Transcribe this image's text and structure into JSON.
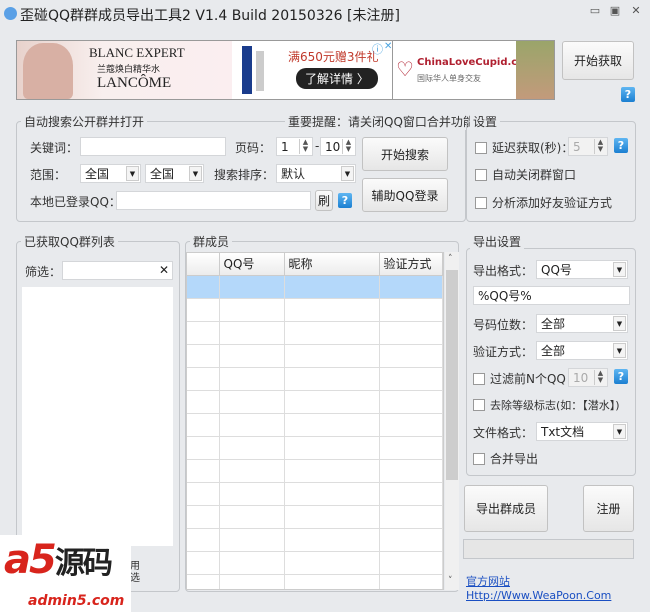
{
  "window": {
    "title": "歪碰QQ群群成员导出工具2 V1.4 Build 20150326   [未注册]",
    "minimize": "▭",
    "maximize": "▣",
    "close": "✕"
  },
  "ads": {
    "lancome_line1": "BLANC EXPERT",
    "lancome_line2": "兰蔻焕白精华水",
    "lancome_brand": "LANCÔME",
    "promo": "满650元赠3件礼",
    "promo_btn": "了解详情 〉",
    "ad_info": "ⓘ",
    "ad_close": "✕",
    "cupid_name": "ChinaLoveCupid.com",
    "cupid_sub": "国际华人单身交友"
  },
  "top": {
    "start_fetch": "开始获取",
    "help": "?"
  },
  "search": {
    "title": "自动搜索公开群并打开",
    "notice": "重要提醒：请关闭QQ窗口合并功能",
    "keyword_label": "关键词：",
    "keyword_value": "",
    "page_label": "页码：",
    "page_from": "1",
    "dash": "-",
    "page_to": "10",
    "start_search": "开始搜索",
    "range_label": "范围：",
    "range1": "全国",
    "range2": "全国",
    "sort_label": "搜索排序：",
    "sort_value": "默认",
    "assist_login": "辅助QQ登录",
    "local_qq_label": "本地已登录QQ：",
    "local_qq_value": "",
    "refresh": "刷",
    "help": "?"
  },
  "settings": {
    "title": "设置",
    "delay_label": "延迟获取(秒)：",
    "delay_value": "5",
    "auto_close": "自动关闭群窗口",
    "analyze": "分析添加好友验证方式",
    "help": "?"
  },
  "export": {
    "title": "导出设置",
    "format_label": "导出格式：",
    "format_value": "QQ号",
    "template_value": "%QQ号%",
    "digits_label": "号码位数：",
    "digits_value": "全部",
    "verify_label": "验证方式：",
    "verify_value": "全部",
    "filter_n_label": "过滤前N个QQ：",
    "filter_n_value": "10",
    "remove_level": "去除等级标志(如：【潜水】)",
    "file_format_label": "文件格式：",
    "file_format_value": "Txt文档",
    "merge": "合并导出",
    "help": "?",
    "export_btn": "导出群成员",
    "register_btn": "注册",
    "progress": 0,
    "site_link": "官方网站 Http://Www.WeaPoon.Com"
  },
  "grouplist": {
    "title": "已获取QQ群列表",
    "filter_label": "筛选：",
    "filter_value": "",
    "clear": "✕",
    "partial1": "用",
    "partial2": "选"
  },
  "members": {
    "title": "群成员",
    "columns": [
      "",
      "QQ号",
      "昵称",
      "验证方式"
    ],
    "rows": 14
  },
  "watermark": {
    "text": "a5源码",
    "domain": "admin5.com"
  }
}
